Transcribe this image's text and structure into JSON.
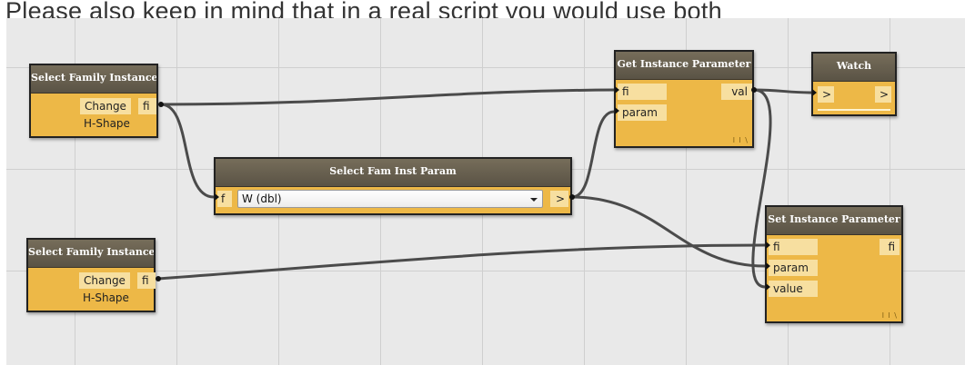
{
  "caption": "Please also keep in mind that in a real script you would use both",
  "colors": {
    "canvas": "#e9e9e9",
    "grid": "#cfcfcf",
    "node_body": "#edb847",
    "node_header": "#6b6250",
    "port": "#f7dfa0",
    "wire": "#4b4b4b"
  },
  "nodes": {
    "sfi1": {
      "title": "Select Family Instance",
      "button": "Change",
      "out_port": "fi",
      "value": "H-Shape"
    },
    "sfi2": {
      "title": "Select Family Instance",
      "button": "Change",
      "out_port": "fi",
      "value": "H-Shape"
    },
    "sfip": {
      "title": "Select Fam Inst Param",
      "in_port": "f",
      "selected": "W (dbl)",
      "out_port": ">"
    },
    "gip": {
      "title": "Get Instance Parameter",
      "in_ports": [
        "fi",
        "param"
      ],
      "out_port": "val",
      "lacing": "l l \\"
    },
    "watch": {
      "title": "Watch",
      "in_port": ">",
      "out_port": ">"
    },
    "sip": {
      "title": "Set Instance Parameter",
      "in_ports": [
        "fi",
        "param",
        "value"
      ],
      "out_port": "fi",
      "lacing": "l l \\"
    }
  }
}
